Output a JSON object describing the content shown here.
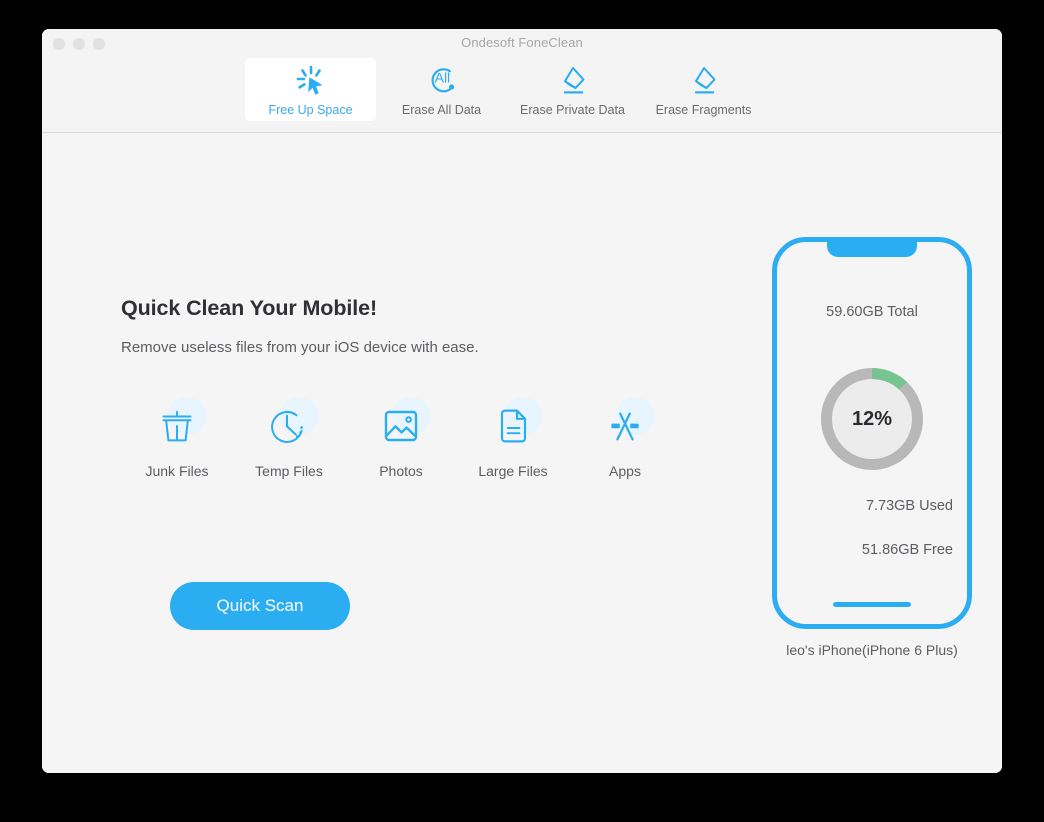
{
  "window": {
    "title": "Ondesoft FoneClean",
    "traffic_lights": [
      "close-button",
      "minimize-button",
      "zoom-button"
    ]
  },
  "toolbar": {
    "items": [
      {
        "label": "Free Up Space",
        "icon": "cursor-click-icon",
        "active": true
      },
      {
        "label": "Erase All Data",
        "icon": "all-circle-icon",
        "active": false
      },
      {
        "label": "Erase Private Data",
        "icon": "eraser-icon",
        "active": false
      },
      {
        "label": "Erase Fragments",
        "icon": "eraser-icon",
        "active": false
      }
    ]
  },
  "main": {
    "headline": "Quick Clean Your Mobile!",
    "subhead": "Remove useless files from your iOS device with ease.",
    "features": [
      {
        "label": "Junk Files",
        "icon": "trash-icon"
      },
      {
        "label": "Temp Files",
        "icon": "clock-icon"
      },
      {
        "label": "Photos",
        "icon": "photo-icon"
      },
      {
        "label": "Large Files",
        "icon": "document-icon"
      },
      {
        "label": "Apps",
        "icon": "app-store-icon"
      }
    ],
    "scan_button": "Quick Scan"
  },
  "device": {
    "total": "59.60GB Total",
    "percent_label": "12%",
    "used": "7.73GB Used",
    "free": "51.86GB Free",
    "name": "leo's iPhone(iPhone 6 Plus)"
  },
  "chart_data": {
    "type": "pie",
    "title": "Storage usage",
    "categories": [
      "Used",
      "Free"
    ],
    "values": [
      7.73,
      51.86
    ],
    "unit": "GB",
    "total": 59.6,
    "percent_used": 12,
    "colors": [
      "#78c490",
      "#b8b8b8"
    ],
    "legend": [
      "7.73GB Used",
      "51.86GB Free"
    ],
    "center_label": "12%"
  },
  "colors": {
    "accent": "#2badf2",
    "accent_text": "#3ba7ef",
    "used_arc": "#78c490",
    "track_arc": "#b8b8b8",
    "window_bg": "#f5f5f5",
    "toolbar_bg": "#f4f4f4",
    "blob": "#e8f5fe",
    "text_dark": "#2f3034",
    "text_muted": "#5c5d61"
  }
}
